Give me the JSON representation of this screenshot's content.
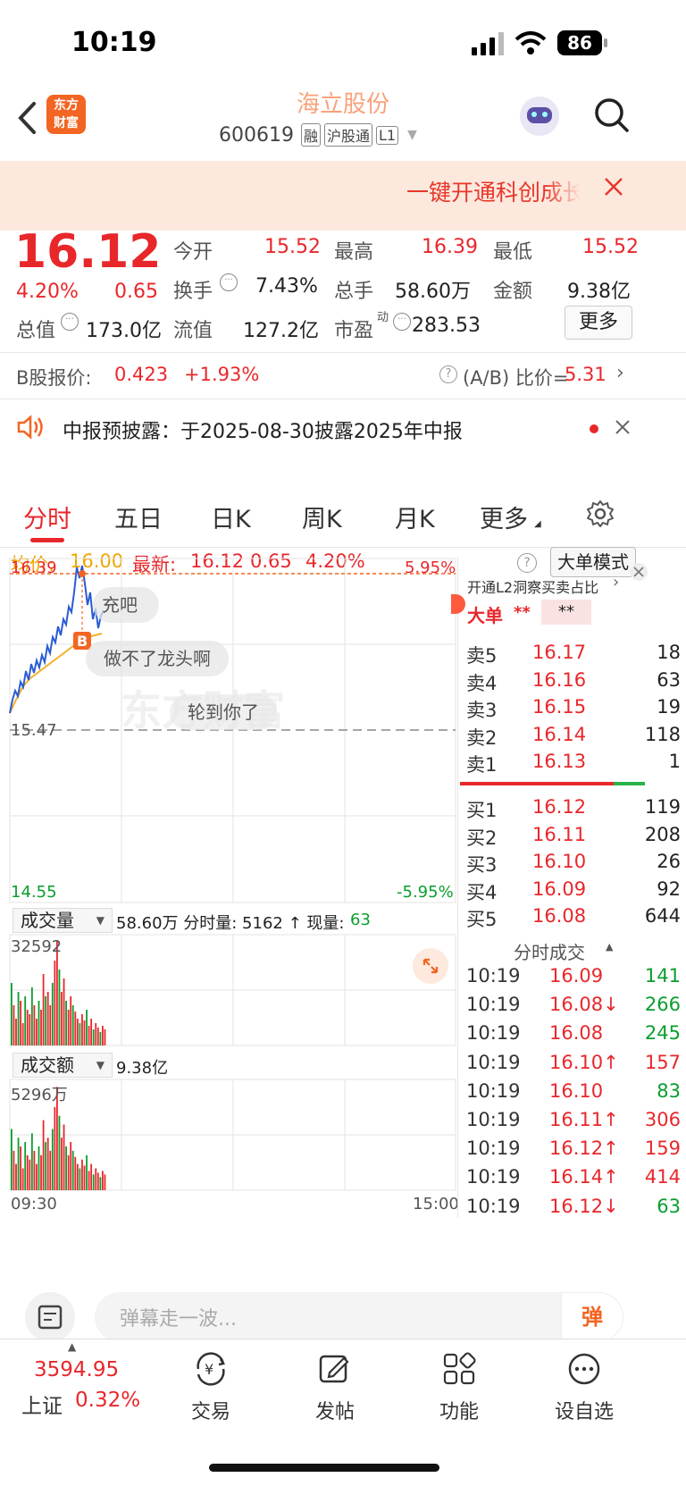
{
  "status": {
    "time": "10:19",
    "battery": "86"
  },
  "header": {
    "stock_name": "海立股份",
    "code": "600619",
    "tags": [
      "融",
      "沪股通",
      "L1"
    ],
    "logo_lines": [
      "东方",
      "财富"
    ]
  },
  "promo": {
    "text": "一键开通科创成长"
  },
  "quote": {
    "price": "16.12",
    "change_pct": "4.20%",
    "change": "0.65",
    "open_label": "今开",
    "open": "15.52",
    "high_label": "最高",
    "high": "16.39",
    "low_label": "最低",
    "low": "15.52",
    "turnover_label": "换手",
    "turnover": "7.43%",
    "volume_label": "总手",
    "volume": "58.60万",
    "amount_label": "金额",
    "amount": "9.38亿",
    "mktcap_label": "总值",
    "mktcap": "173.0亿",
    "float_label": "流值",
    "float": "127.2亿",
    "pe_label": "市盈",
    "pe_sup": "动",
    "pe": "283.53",
    "more_label": "更多"
  },
  "bshare": {
    "label": "B股报价:",
    "price": "0.423",
    "pct": "+1.93%",
    "ratio_label": "(A/B) 比价=",
    "ratio": "5.31"
  },
  "notice": {
    "text": "中报预披露：于2025-08-30披露2025年中报"
  },
  "tabs": [
    "分时",
    "五日",
    "日K",
    "周K",
    "月K",
    "更多"
  ],
  "infobar": {
    "avg_label": "均价:",
    "avg": "16.00",
    "latest_label": "最新:",
    "latest": "16.12",
    "chg": "0.65",
    "pct": "4.20%",
    "mode_btn": "大单模式"
  },
  "chart": {
    "y_top": "16.39",
    "y_mid": "15.47",
    "y_bot": "14.55",
    "pct_top": "5.95%",
    "pct_bot": "-5.95%",
    "danmaku": [
      "充吧",
      "做不了龙头啊",
      "轮到你了"
    ],
    "buy_marker": "B",
    "vol_label": "成交量",
    "vol_info": "58.60万 分时量: 5162 ↑ 现量:",
    "vol_now": "63",
    "vol_max": "32592",
    "amt_label": "成交额",
    "amt_info": "9.38亿",
    "amt_max": "5296万",
    "time_start": "09:30",
    "time_end": "15:00",
    "watermark": "东方财富"
  },
  "chart_data": {
    "type": "line",
    "x_range": [
      "09:30",
      "15:00"
    ],
    "ylim": [
      14.55,
      16.39
    ],
    "prev_close": 15.47,
    "series": []
  },
  "orderbook": {
    "header": "开通L2洞察买卖占比",
    "big_label": "大单",
    "big_a": "**",
    "big_b": "**",
    "asks": [
      {
        "label": "卖5",
        "price": "16.17",
        "vol": "18"
      },
      {
        "label": "卖4",
        "price": "16.16",
        "vol": "63"
      },
      {
        "label": "卖3",
        "price": "16.15",
        "vol": "19"
      },
      {
        "label": "卖2",
        "price": "16.14",
        "vol": "118"
      },
      {
        "label": "卖1",
        "price": "16.13",
        "vol": "1"
      }
    ],
    "bids": [
      {
        "label": "买1",
        "price": "16.12",
        "vol": "119"
      },
      {
        "label": "买2",
        "price": "16.11",
        "vol": "208"
      },
      {
        "label": "买3",
        "price": "16.10",
        "vol": "26"
      },
      {
        "label": "买4",
        "price": "16.09",
        "vol": "92"
      },
      {
        "label": "买5",
        "price": "16.08",
        "vol": "644"
      }
    ],
    "ticks_title": "分时成交",
    "ticks": [
      {
        "t": "10:19",
        "p": "16.09",
        "v": "141",
        "c": "red",
        "g": "green"
      },
      {
        "t": "10:19",
        "p": "16.08↓",
        "v": "266",
        "c": "red",
        "g": "green"
      },
      {
        "t": "10:19",
        "p": "16.08",
        "v": "245",
        "c": "red",
        "g": "green"
      },
      {
        "t": "10:19",
        "p": "16.10↑",
        "v": "157",
        "c": "red",
        "g": "red"
      },
      {
        "t": "10:19",
        "p": "16.10",
        "v": "83",
        "c": "red",
        "g": "green"
      },
      {
        "t": "10:19",
        "p": "16.11↑",
        "v": "306",
        "c": "red",
        "g": "red"
      },
      {
        "t": "10:19",
        "p": "16.12↑",
        "v": "159",
        "c": "red",
        "g": "red"
      },
      {
        "t": "10:19",
        "p": "16.14↑",
        "v": "414",
        "c": "red",
        "g": "red"
      },
      {
        "t": "10:19",
        "p": "16.12↓",
        "v": "63",
        "c": "red",
        "g": "green"
      }
    ]
  },
  "danmu_input": {
    "placeholder": "弹幕走一波...",
    "btn": "弹"
  },
  "bottom": {
    "index_value": "3594.95",
    "index_name": "上证",
    "index_pct": "0.32%",
    "items": [
      "交易",
      "发帖",
      "功能",
      "设自选"
    ]
  }
}
